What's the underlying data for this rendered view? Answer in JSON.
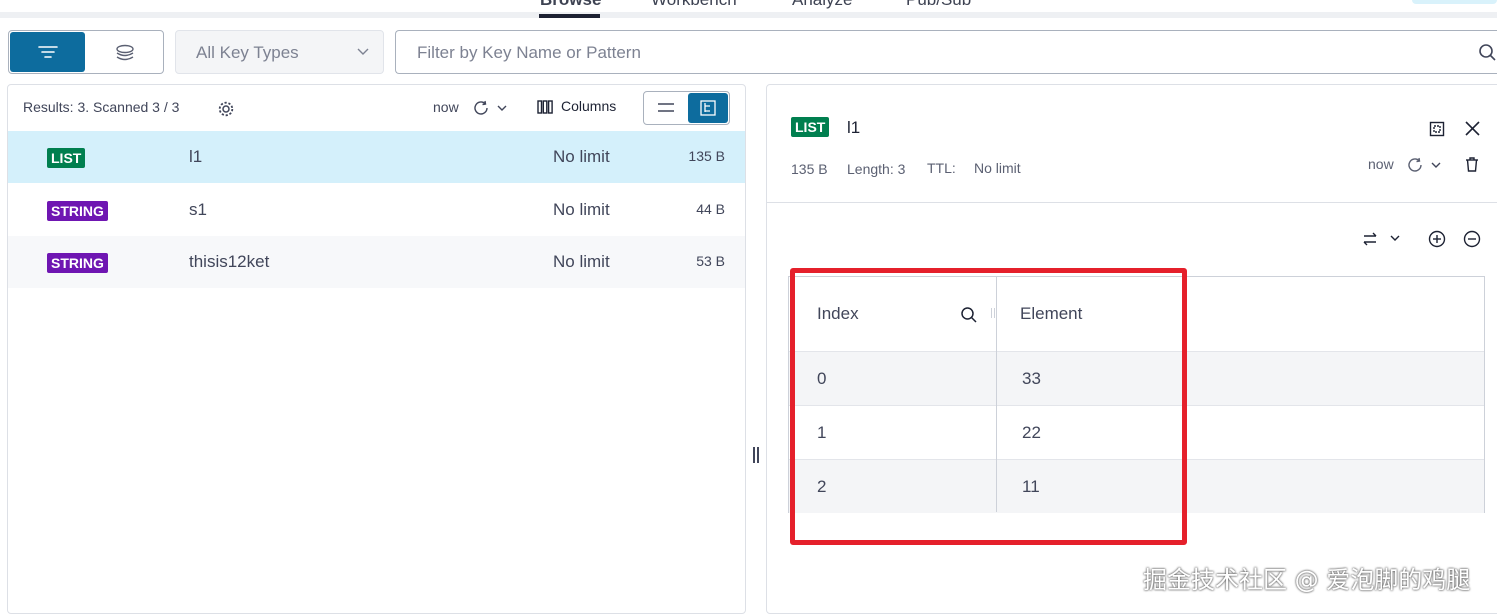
{
  "nav": {
    "tabs": [
      {
        "label": "Browse"
      },
      {
        "label": "Workbench"
      },
      {
        "label": "Analyze"
      },
      {
        "label": "Pub/Sub"
      }
    ]
  },
  "toolbar": {
    "key_type_filter": "All Key Types",
    "search_placeholder": "Filter by Key Name or Pattern"
  },
  "keys_panel": {
    "results_text": "Results: 3. Scanned 3 / 3",
    "refresh_label": "now",
    "columns_label": "Columns",
    "rows": [
      {
        "type": "LIST",
        "name": "l1",
        "ttl": "No limit",
        "size": "135 B",
        "selected": true
      },
      {
        "type": "STRING",
        "name": "s1",
        "ttl": "No limit",
        "size": "44 B",
        "selected": false
      },
      {
        "type": "STRING",
        "name": "thisis12ket",
        "ttl": "No limit",
        "size": "53 B",
        "selected": false
      }
    ]
  },
  "detail": {
    "type": "LIST",
    "key_name": "l1",
    "size": "135 B",
    "length_label": "Length: 3",
    "ttl_label": "TTL:",
    "ttl_value": "No limit",
    "refresh_label": "now",
    "table": {
      "headers": [
        "Index",
        "Element"
      ],
      "rows": [
        {
          "index": "0",
          "element": "33"
        },
        {
          "index": "1",
          "element": "22"
        },
        {
          "index": "2",
          "element": "11"
        }
      ]
    }
  },
  "watermark": "掘金技术社区 @ 爱泡脚的鸡腿",
  "colors": {
    "accent": "#0d6c9e",
    "list_badge": "#007f4f",
    "string_badge": "#6f16b2",
    "selected_row": "#d4f0fb",
    "highlight_box": "#e5202b"
  }
}
